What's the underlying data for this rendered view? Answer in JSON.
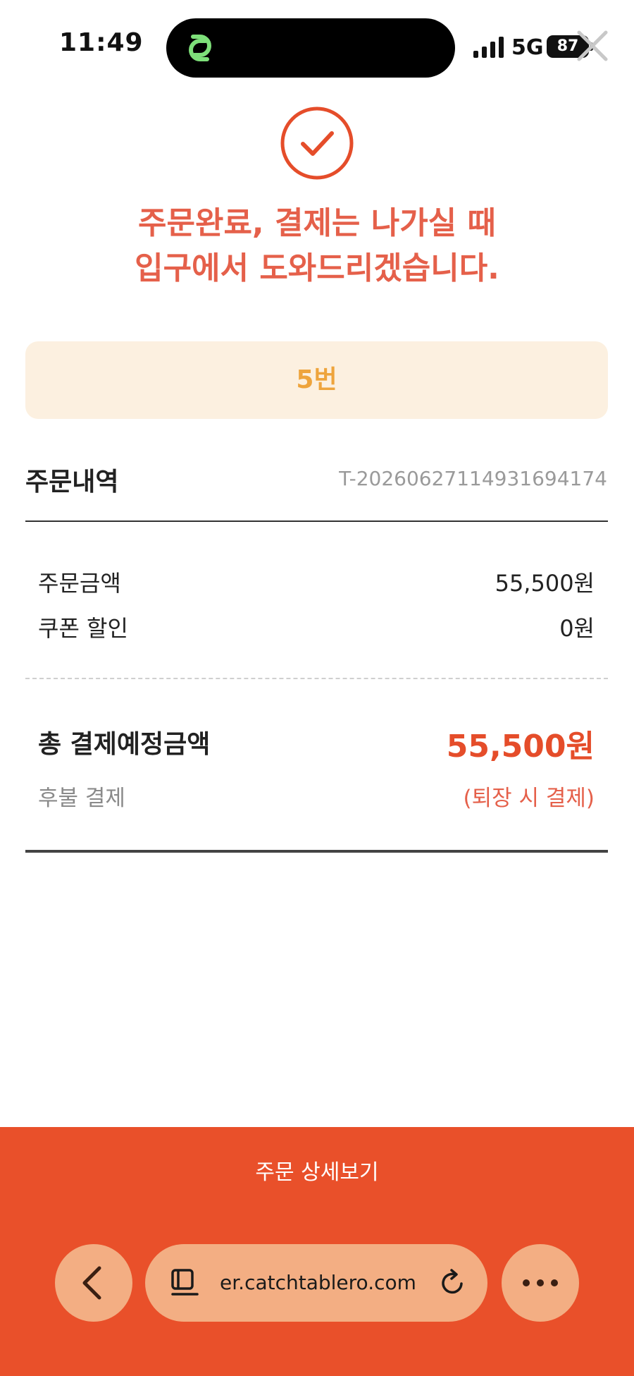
{
  "status_bar": {
    "time": "11:49",
    "network": "5G",
    "battery": "87"
  },
  "header": {
    "title_line1": "주문완료, 결제는 나가실 때",
    "title_line2": "입구에서 도와드리겠습니다."
  },
  "order_number": "5번",
  "order_details": {
    "section_title": "주문내역",
    "order_id": "T-20260627114931694174",
    "rows": [
      {
        "label": "주문금액",
        "value": "55,500원"
      },
      {
        "label": "쿠폰 할인",
        "value": "0원"
      }
    ],
    "total_label": "총 결제예정금액",
    "total_value": "55,500원",
    "deferred_label": "후불 결제",
    "deferred_note": "(퇴장 시 결제)"
  },
  "bottom": {
    "details_button": "주문 상세보기",
    "url": "er.catchtablero.com"
  },
  "icons": {
    "close": "close-icon",
    "check": "check-circle-icon",
    "back": "chevron-left-icon",
    "tabs": "tabs-icon",
    "reload": "reload-icon",
    "more": "more-icon"
  },
  "colors": {
    "accent": "#e54d2a",
    "title": "#e5604a",
    "banner_bg": "#fcf0e0",
    "banner_text": "#eea43c",
    "bottom_bar": "#e9502a",
    "pill": "#f3ae83"
  }
}
